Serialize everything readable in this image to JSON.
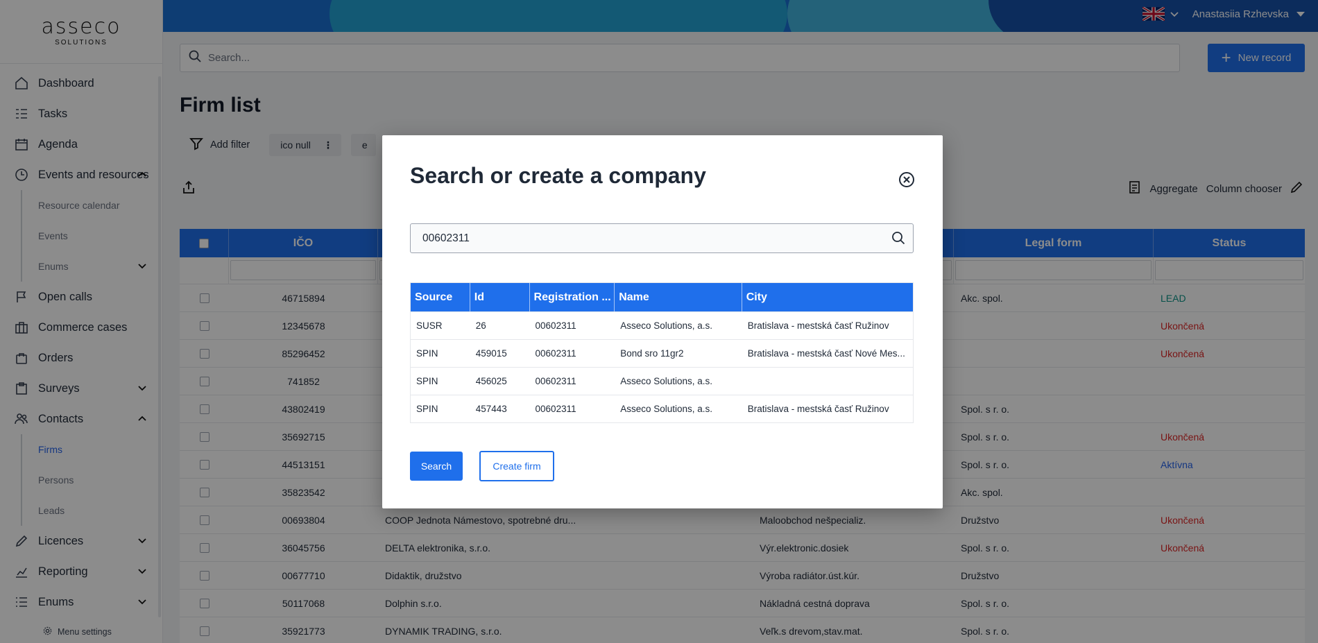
{
  "brand": {
    "logo_word": "asseco",
    "logo_sub": "SOLUTIONS"
  },
  "sidebar": {
    "items": [
      {
        "label": "Dashboard",
        "icon": "home-icon"
      },
      {
        "label": "Tasks",
        "icon": "tasks-icon"
      },
      {
        "label": "Agenda",
        "icon": "calendar-icon"
      },
      {
        "label": "Events and resources",
        "icon": "clock-icon",
        "expanded": true,
        "children": [
          {
            "label": "Resource calendar"
          },
          {
            "label": "Events"
          },
          {
            "label": "Enums"
          }
        ]
      },
      {
        "label": "Open calls",
        "icon": "flag-icon"
      },
      {
        "label": "Commerce cases",
        "icon": "briefcase-icon"
      },
      {
        "label": "Orders",
        "icon": "bag-icon"
      },
      {
        "label": "Surveys",
        "icon": "clipboard-icon"
      },
      {
        "label": "Contacts",
        "icon": "users-icon",
        "expanded": true,
        "children": [
          {
            "label": "Firms",
            "active": true
          },
          {
            "label": "Persons"
          },
          {
            "label": "Leads"
          }
        ]
      },
      {
        "label": "Licences",
        "icon": "pen-icon"
      },
      {
        "label": "Reporting",
        "icon": "chart-icon"
      },
      {
        "label": "Enums",
        "icon": "list-icon"
      }
    ],
    "menu_settings": "Menu settings"
  },
  "header": {
    "user_name": "Anastasiia Rzhevska",
    "language": "EN"
  },
  "search": {
    "placeholder": "Search..."
  },
  "new_record_label": "New record",
  "page_title": "Firm list",
  "filters": {
    "add_filter_label": "Add filter",
    "chips": [
      "ico null",
      "e"
    ]
  },
  "toolbar": {
    "aggregate_label": "Aggregate",
    "column_chooser_label": "Column chooser"
  },
  "grid": {
    "headers": {
      "ico": "IČO",
      "legal_form": "Legal form",
      "status": "Status"
    },
    "rows": [
      {
        "ico": "46715894",
        "name": "",
        "activity": "",
        "legal_form": "Akc. spol.",
        "status": "LEAD",
        "status_color": "teal"
      },
      {
        "ico": "12345678",
        "name": "",
        "activity": "",
        "legal_form": "",
        "status": "Ukončená",
        "status_color": "red"
      },
      {
        "ico": "85296452",
        "name": "",
        "activity": "",
        "legal_form": "",
        "status": "Ukončená",
        "status_color": "red"
      },
      {
        "ico": "741852",
        "name": "",
        "activity": "",
        "legal_form": "",
        "status": "",
        "status_color": ""
      },
      {
        "ico": "43802419",
        "name": "",
        "activity": "",
        "legal_form": "Spol. s r. o.",
        "status": "",
        "status_color": ""
      },
      {
        "ico": "35692715",
        "name": "",
        "activity": "",
        "legal_form": "Spol. s r. o.",
        "status": "Ukončená",
        "status_color": "red"
      },
      {
        "ico": "44513151",
        "name": "",
        "activity": "",
        "legal_form": "Spol. s r. o.",
        "status": "Aktívna",
        "status_color": "blue"
      },
      {
        "ico": "35823542",
        "name": "",
        "activity": "",
        "legal_form": "Akc. spol.",
        "status": "",
        "status_color": ""
      },
      {
        "ico": "00693804",
        "name": "COOP Jednota Námestovo, spotrebné dru...",
        "activity": "Maloobchod nešpecializ.",
        "legal_form": "Družstvo",
        "status": "Ukončená",
        "status_color": "red"
      },
      {
        "ico": "36045756",
        "name": "DELTA elektronika, s.r.o.",
        "activity": "Výr.elektronic.dosiek",
        "legal_form": "Spol. s r. o.",
        "status": "Ukončená",
        "status_color": "red"
      },
      {
        "ico": "00677710",
        "name": "Didaktik, družstvo",
        "activity": "Výroba radiátor.úst.kúr.",
        "legal_form": "Družstvo",
        "status": "",
        "status_color": ""
      },
      {
        "ico": "50117068",
        "name": "Dolphin s.r.o.",
        "activity": "Nákladná cestná doprava",
        "legal_form": "Spol. s r. o.",
        "status": "",
        "status_color": ""
      },
      {
        "ico": "35921773",
        "name": "DYNAMIK TRADING, s.r.o.",
        "activity": "Veľk.s drevom,stav.mat.",
        "legal_form": "Spol. s r. o.",
        "status": "",
        "status_color": ""
      }
    ]
  },
  "modal": {
    "title": "Search or create a company",
    "search_value": "00602311",
    "columns": [
      "Source",
      "Id",
      "Registration ...",
      "Name",
      "City"
    ],
    "rows": [
      {
        "source": "SUSR",
        "id": "26",
        "registration": "00602311",
        "name": "Asseco Solutions, a.s.",
        "city": "Bratislava - mestská časť Ružinov"
      },
      {
        "source": "SPIN",
        "id": "459015",
        "registration": "00602311",
        "name": "Bond sro 11gr2",
        "city": "Bratislava - mestská časť Nové Mes..."
      },
      {
        "source": "SPIN",
        "id": "456025",
        "registration": "00602311",
        "name": "Asseco Solutions, a.s.",
        "city": ""
      },
      {
        "source": "SPIN",
        "id": "457443",
        "registration": "00602311",
        "name": "Asseco Solutions, a.s.",
        "city": "Bratislava - mestská časť Ružinov"
      }
    ],
    "search_button": "Search",
    "create_button": "Create firm"
  }
}
